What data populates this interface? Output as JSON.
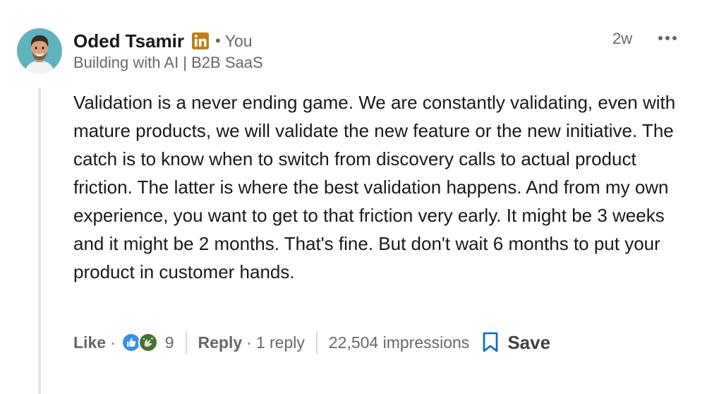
{
  "comment": {
    "author": {
      "name": "Oded Tsamir",
      "badge_icon": "linkedin-icon",
      "relation": "You",
      "headline": "Building with AI | B2B SaaS"
    },
    "timestamp": "2w",
    "more_icon": "ellipsis-icon",
    "body": "Validation is a never ending game. We are constantly validating, even with mature products, we will validate the new feature or the new initiative. The catch is to know when to switch from discovery calls to actual product friction. The latter is where the best validation happens. And from my own experience, you want to get to that friction very early. It might be 3 weeks and it might be 2 months. That's fine. But don't wait 6 months to put your product in customer hands.",
    "actions": {
      "like_label": "Like",
      "reactions": [
        "like-icon",
        "celebrate-icon"
      ],
      "reaction_count": "9",
      "reply_label": "Reply",
      "reply_count": "1 reply",
      "impressions": "22,504 impressions",
      "save_label": "Save",
      "save_icon": "bookmark-icon"
    }
  },
  "colors": {
    "linkedin_blue": "#0a66c2",
    "like_blue": "#378fe9",
    "celebrate_green": "#44712e",
    "thread_line": "#e8e6e1"
  }
}
